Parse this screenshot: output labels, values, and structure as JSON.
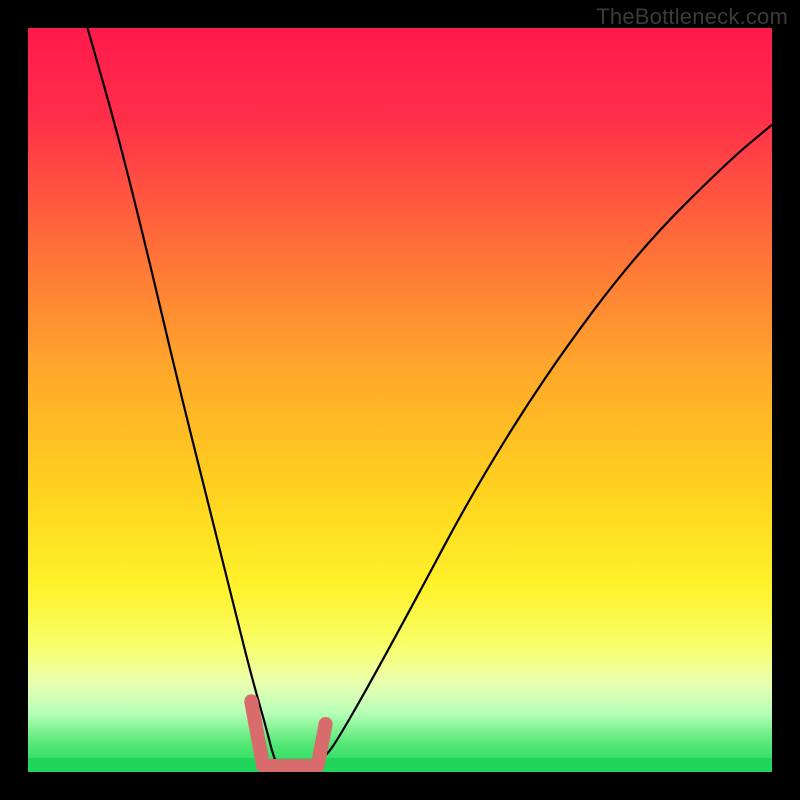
{
  "watermark": {
    "text": "TheBottleneck.com"
  },
  "colors": {
    "curve_stroke": "#000000",
    "marker_stroke": "#d86b6b",
    "green_band": "#1fd65a",
    "gradient_stops": [
      {
        "offset": "0%",
        "color": "#ff1a4d"
      },
      {
        "offset": "12%",
        "color": "#ff2e4a"
      },
      {
        "offset": "28%",
        "color": "#ff6a3a"
      },
      {
        "offset": "45%",
        "color": "#ffa52c"
      },
      {
        "offset": "62%",
        "color": "#ffd21f"
      },
      {
        "offset": "75%",
        "color": "#fff22a"
      },
      {
        "offset": "83%",
        "color": "#f8ff6a"
      },
      {
        "offset": "88%",
        "color": "#eaffb0"
      },
      {
        "offset": "92%",
        "color": "#b8ffb8"
      },
      {
        "offset": "96%",
        "color": "#58e978"
      },
      {
        "offset": "100%",
        "color": "#1fd65a"
      }
    ]
  },
  "chart_data": {
    "type": "line",
    "title": "",
    "xlabel": "",
    "ylabel": "",
    "xlim": [
      0,
      1
    ],
    "ylim": [
      0,
      1
    ],
    "grid": false,
    "series": [
      {
        "name": "bottleneck-curve",
        "x": [
          0.08,
          0.12,
          0.16,
          0.2,
          0.24,
          0.28,
          0.3,
          0.32,
          0.33,
          0.34,
          0.36,
          0.38,
          0.4,
          0.42,
          0.46,
          0.52,
          0.6,
          0.7,
          0.82,
          0.94,
          1.0
        ],
        "y": [
          1.0,
          0.86,
          0.7,
          0.53,
          0.37,
          0.21,
          0.13,
          0.06,
          0.02,
          0.0,
          0.0,
          0.01,
          0.02,
          0.05,
          0.12,
          0.23,
          0.38,
          0.54,
          0.7,
          0.82,
          0.87
        ]
      }
    ],
    "annotations": [
      {
        "name": "valley-marker",
        "shape": "v",
        "x_start": 0.3,
        "x_end": 0.4,
        "y_base": 0.0,
        "y_top": 0.095
      }
    ]
  }
}
